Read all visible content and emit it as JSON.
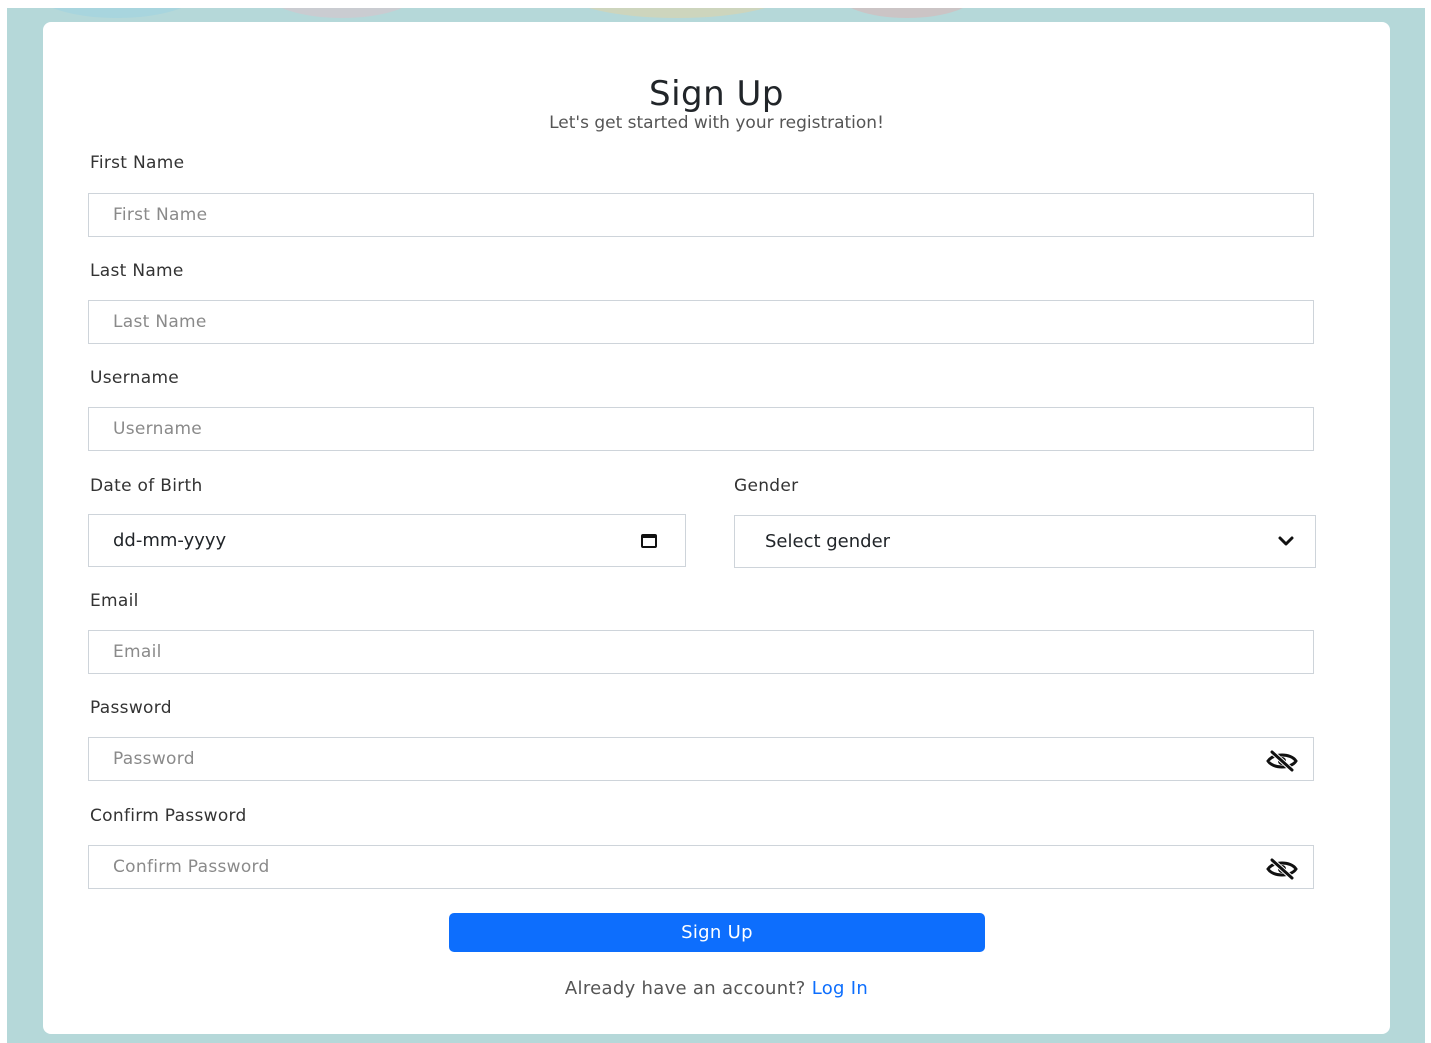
{
  "form": {
    "title": "Sign Up",
    "subtitle": "Let's get started with your registration!",
    "first_name": {
      "label": "First Name",
      "placeholder": "First Name",
      "value": ""
    },
    "last_name": {
      "label": "Last Name",
      "placeholder": "Last Name",
      "value": ""
    },
    "username": {
      "label": "Username",
      "placeholder": "Username",
      "value": ""
    },
    "dob": {
      "label": "Date of Birth",
      "value": "dd-mm-yyyy",
      "icon": "calendar-icon"
    },
    "gender": {
      "label": "Gender",
      "selected": "Select gender",
      "icon": "chevron-down-icon"
    },
    "email": {
      "label": "Email",
      "placeholder": "Email",
      "value": ""
    },
    "password": {
      "label": "Password",
      "placeholder": "Password",
      "value": "",
      "icon": "eye-slash-icon"
    },
    "confirm_password": {
      "label": "Confirm Password",
      "placeholder": "Confirm Password",
      "value": "",
      "icon": "eye-slash-icon"
    },
    "submit_label": "Sign Up",
    "footer_text": "Already have an account?",
    "login_link": "Log In"
  },
  "colors": {
    "background": "#b5d8d9",
    "accent": "#0d6efd",
    "card": "#ffffff"
  }
}
